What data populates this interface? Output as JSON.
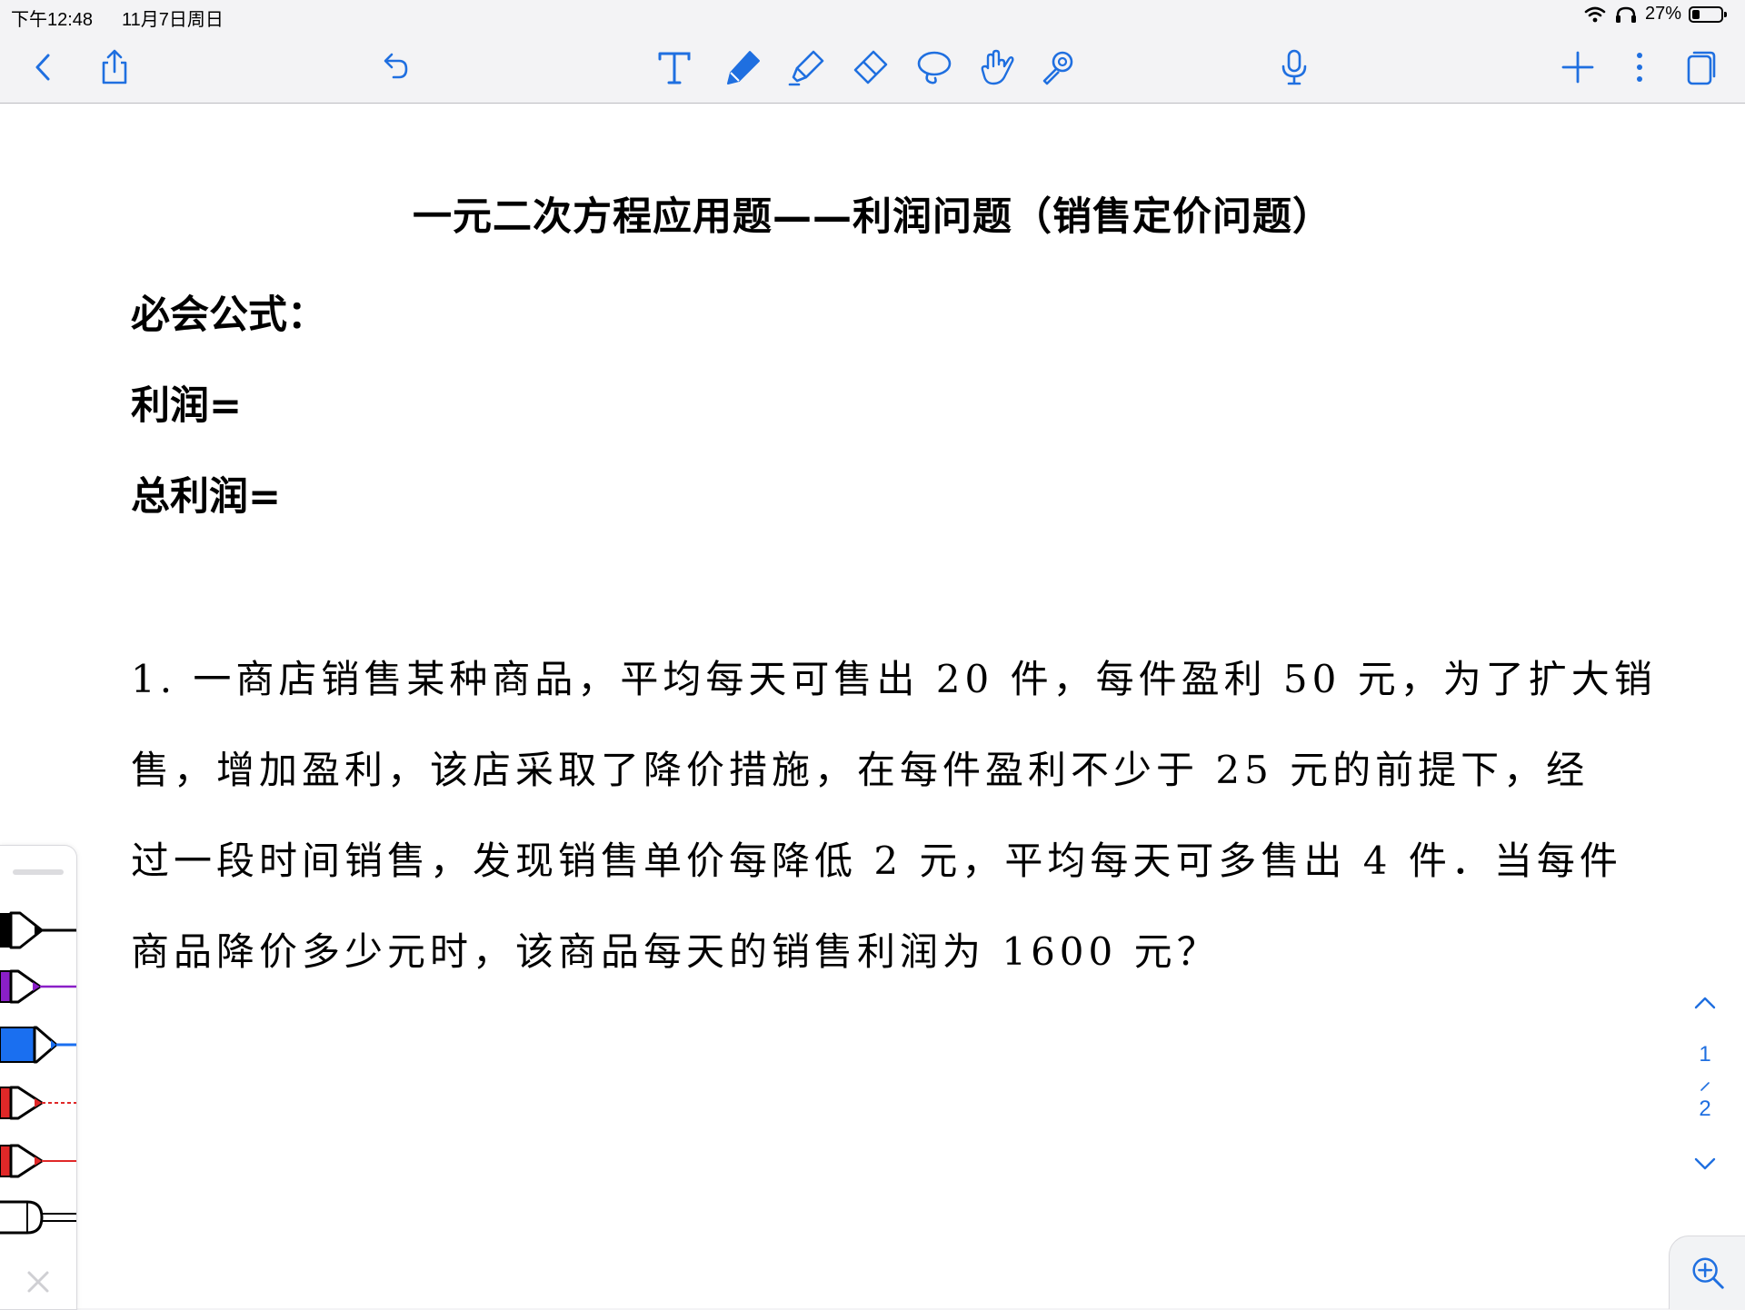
{
  "status": {
    "time": "下午12:48",
    "date": "11月7日周日",
    "battery": "27%",
    "battery_level": 0.27,
    "icons": [
      "wifi-icon",
      "headphones-icon",
      "battery-icon"
    ]
  },
  "toolbar": {
    "left": [
      "back-icon",
      "share-icon",
      "undo-icon"
    ],
    "tools": [
      "text-tool-icon",
      "pen-icon",
      "highlighter-icon",
      "eraser-icon",
      "lasso-icon",
      "hand-pointer-icon",
      "laser-pointer-icon"
    ],
    "right": [
      "microphone-icon",
      "add-icon",
      "more-icon",
      "pages-icon"
    ],
    "accent": "#1f6fe0"
  },
  "document": {
    "title": "一元二次方程应用题——利润问题（销售定价问题）",
    "formulas": [
      "必会公式：",
      "利润=",
      "总利润="
    ],
    "problem_lines": [
      "1. 一商店销售某种商品，平均每天可售出 20 件，每件盈利 50 元，为了扩大销",
      "售，增加盈利，该店采取了降价措施，在每件盈利不少于 25 元的前提下，经",
      "过一段时间销售，发现销售单价每降低 2 元，平均每天可多售出 4 件．当每件",
      "商品降价多少元时，该商品每天的销售利润为 1600 元？"
    ]
  },
  "palette": {
    "pens": [
      {
        "name": "pen-black",
        "color": "#000000"
      },
      {
        "name": "pen-purple",
        "color": "#8a1fc7"
      },
      {
        "name": "pen-blue",
        "color": "#1a6ff0"
      },
      {
        "name": "pen-red-dashed",
        "color": "#e02828"
      },
      {
        "name": "pen-red",
        "color": "#e02828"
      },
      {
        "name": "pen-white",
        "color": "#ffffff"
      }
    ]
  },
  "pager": {
    "current": "1",
    "total": "2"
  }
}
